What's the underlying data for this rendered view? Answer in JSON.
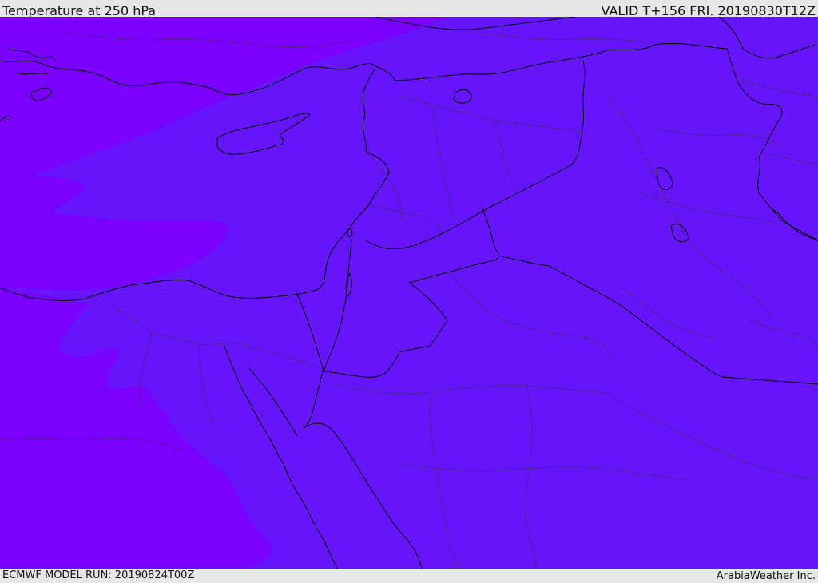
{
  "header": {
    "title": "Temperature at 250 hPa",
    "valid": "VALID T+156 FRI. 20190830T12Z"
  },
  "footer": {
    "model_run": "ECMWF MODEL RUN: 20190824T00Z",
    "credit": "ArabiaWeather Inc."
  },
  "map": {
    "colors": {
      "warmer_band": "#7a00ff",
      "cooler_band": "#6615fb",
      "coastline": "#000000",
      "border": "#000000",
      "province_border": "#333333"
    }
  }
}
